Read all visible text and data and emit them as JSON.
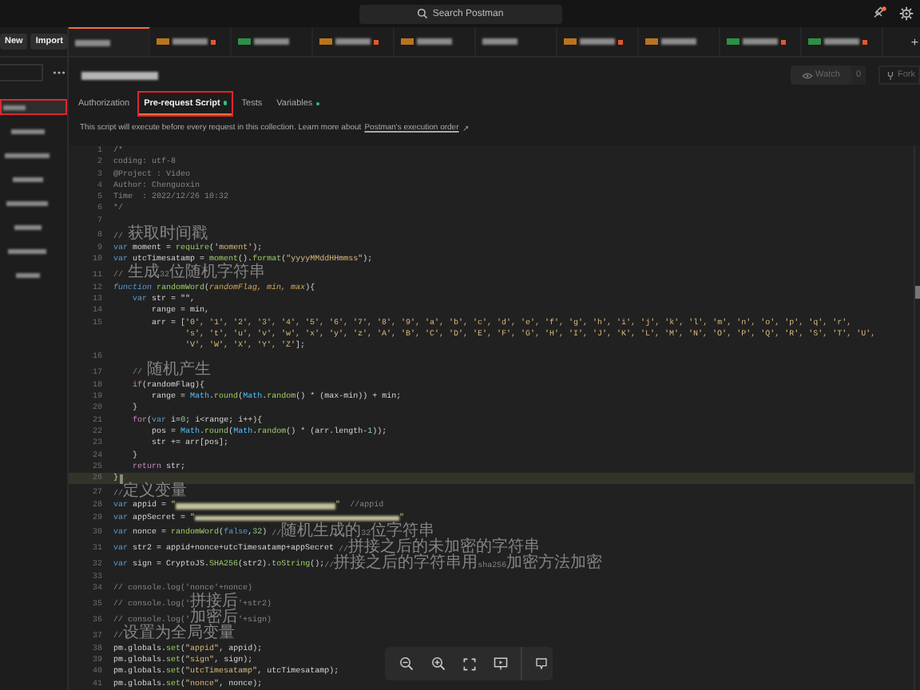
{
  "topbar": {
    "search": {
      "placeholder": "Search Postman"
    },
    "notification": true
  },
  "sidebar": {
    "buttons": [
      "New",
      "Import"
    ],
    "items": [
      {
        "selected": true,
        "highlighted": true
      },
      {
        "selected": false,
        "highlighted": false
      },
      {
        "selected": false,
        "highlighted": false
      },
      {
        "selected": false,
        "highlighted": false
      },
      {
        "selected": false,
        "highlighted": false
      },
      {
        "selected": false,
        "highlighted": false
      },
      {
        "selected": false,
        "highlighted": false
      },
      {
        "selected": false,
        "highlighted": false
      }
    ]
  },
  "tabs": [
    {
      "selected": true,
      "unsaved": false
    },
    {
      "selected": false,
      "color": "#b8741f",
      "unsaved": true
    },
    {
      "selected": false,
      "color": "#2f8f46",
      "unsaved": false
    },
    {
      "selected": false,
      "color": "#b8741f",
      "unsaved": true
    },
    {
      "selected": false,
      "color": "#b8741f",
      "unsaved": false
    },
    {
      "selected": false,
      "unsaved": false
    },
    {
      "selected": false,
      "color": "#b8741f",
      "unsaved": true
    },
    {
      "selected": false,
      "color": "#b8741f",
      "unsaved": false
    },
    {
      "selected": false,
      "color": "#2f8f46",
      "unsaved": true
    },
    {
      "selected": false,
      "color": "#2f8f46",
      "unsaved": true
    }
  ],
  "new_tab": "+",
  "collection": {
    "watch": {
      "label": "Watch",
      "count": "0"
    },
    "fork": {
      "label": "Fork"
    }
  },
  "subtabs": [
    {
      "label": "Authorization",
      "selected": false,
      "dot": false,
      "highlighted": false
    },
    {
      "label": "Pre-request Script",
      "selected": true,
      "dot": true,
      "highlighted": true
    },
    {
      "label": "Tests",
      "selected": false,
      "dot": false,
      "highlighted": false
    },
    {
      "label": "Variables",
      "selected": false,
      "dot": true,
      "highlighted": false
    }
  ],
  "info": {
    "text": "This script will execute before every request in this collection. Learn more about",
    "link": "Postman's execution order",
    "arrow": "↗"
  },
  "editor": {
    "lines": [
      {
        "n": "1",
        "current": false,
        "segs": [
          {
            "kind": "cm",
            "text": "/*"
          }
        ]
      },
      {
        "n": "2",
        "current": false,
        "segs": [
          {
            "kind": "cm",
            "text": "coding: utf-8"
          }
        ]
      },
      {
        "n": "3",
        "current": false,
        "segs": [
          {
            "kind": "cm",
            "text": "@Project : Video"
          }
        ]
      },
      {
        "n": "4",
        "current": false,
        "segs": [
          {
            "kind": "cm",
            "text": "Author: Chenguoxin"
          }
        ]
      },
      {
        "n": "5",
        "current": false,
        "segs": [
          {
            "kind": "cm",
            "text": "Time  : 2022/12/26 10:32"
          }
        ]
      },
      {
        "n": "6",
        "current": false,
        "segs": [
          {
            "kind": "cm",
            "text": "*/"
          }
        ]
      },
      {
        "n": "7",
        "current": false
      },
      {
        "n": "8",
        "current": false,
        "segs": [
          {
            "kind": "cm",
            "text": "// 获取时间戳"
          }
        ]
      },
      {
        "n": "9",
        "current": false,
        "segs": [
          {
            "kind": "kw",
            "text": "var"
          },
          {
            "kind": "pl",
            "text": " moment = "
          },
          {
            "kind": "fn",
            "text": "require"
          },
          {
            "kind": "pl",
            "text": "("
          },
          {
            "kind": "str",
            "text": "'moment'"
          },
          {
            "kind": "pl",
            "text": ");"
          }
        ]
      },
      {
        "n": "10",
        "current": false,
        "segs": [
          {
            "kind": "kw",
            "text": "var"
          },
          {
            "kind": "pl",
            "text": " utcTimesatamp = "
          },
          {
            "kind": "fn",
            "text": "moment"
          },
          {
            "kind": "pl",
            "text": "()."
          },
          {
            "kind": "fn",
            "text": "format"
          },
          {
            "kind": "pl",
            "text": "("
          },
          {
            "kind": "str",
            "text": "\"yyyyMMddHHmmss\""
          },
          {
            "kind": "pl",
            "text": ");"
          }
        ]
      },
      {
        "n": "11",
        "current": false,
        "segs": [
          {
            "kind": "cm",
            "text": "// 生成32位随机字符串"
          }
        ]
      },
      {
        "n": "12",
        "current": false,
        "segs": [
          {
            "kind": "kwi",
            "text": "function"
          },
          {
            "kind": "fn",
            "text": " randomWord"
          },
          {
            "kind": "pl",
            "text": "("
          },
          {
            "kind": "param",
            "text": "randomFlag, min, max"
          },
          {
            "kind": "pl",
            "text": "){"
          }
        ]
      },
      {
        "n": "13",
        "current": false,
        "segs": [
          {
            "kind": "kw",
            "text": "    var"
          },
          {
            "kind": "pl",
            "text": " str = \"\","
          }
        ]
      },
      {
        "n": "14",
        "current": false,
        "segs": [
          {
            "kind": "pl",
            "text": "        range = min,"
          }
        ]
      },
      {
        "n": "15",
        "current": false,
        "segs": [
          {
            "kind": "pl",
            "text": "        arr = ["
          },
          {
            "kind": "str",
            "text": "'0', '1', '2', '3', '4', '5', '6', '7', '8', '9', 'a', 'b', 'c', 'd', 'e', 'f', 'g', 'h', 'i', 'j', 'k', 'l', 'm', 'n', 'o', 'p', 'q', 'r',"
          }
        ]
      },
      {
        "current": false,
        "segs": [
          {
            "kind": "str",
            "text": "               's', 't', 'u', 'v', 'w', 'x', 'y', 'z', 'A', 'B', 'C', 'D', 'E', 'F', 'G', 'H', 'I', 'J', 'K', 'L', 'M', 'N', 'O', 'P', 'Q', 'R', 'S', 'T', 'U',"
          }
        ]
      },
      {
        "current": false,
        "segs": [
          {
            "kind": "str",
            "text": "               'V', 'W', 'X', 'Y', 'Z'"
          },
          {
            "kind": "pl",
            "text": "];"
          }
        ]
      },
      {
        "n": "16",
        "current": false
      },
      {
        "n": "17",
        "current": false,
        "segs": [
          {
            "kind": "cm",
            "text": "    // 随机产生"
          }
        ]
      },
      {
        "n": "18",
        "current": false,
        "segs": [
          {
            "kind": "ctl",
            "text": "    if"
          },
          {
            "kind": "pl",
            "text": "(randomFlag){"
          }
        ]
      },
      {
        "n": "19",
        "current": false,
        "segs": [
          {
            "kind": "pl",
            "text": "        range = "
          },
          {
            "kind": "obj",
            "text": "Math"
          },
          {
            "kind": "pl",
            "text": "."
          },
          {
            "kind": "fn",
            "text": "round"
          },
          {
            "kind": "pl",
            "text": "("
          },
          {
            "kind": "obj",
            "text": "Math"
          },
          {
            "kind": "pl",
            "text": "."
          },
          {
            "kind": "fn",
            "text": "random"
          },
          {
            "kind": "pl",
            "text": "() * (max-min)) + min;"
          }
        ]
      },
      {
        "n": "20",
        "current": false,
        "segs": [
          {
            "kind": "pl",
            "text": "    }"
          }
        ]
      },
      {
        "n": "21",
        "current": false,
        "segs": [
          {
            "kind": "ctl",
            "text": "    for"
          },
          {
            "kind": "pl",
            "text": "("
          },
          {
            "kind": "kw",
            "text": "var"
          },
          {
            "kind": "pl",
            "text": " i="
          },
          {
            "kind": "num",
            "text": "0"
          },
          {
            "kind": "pl",
            "text": "; i<range; i++){"
          }
        ]
      },
      {
        "n": "22",
        "current": false,
        "segs": [
          {
            "kind": "pl",
            "text": "        pos = "
          },
          {
            "kind": "obj",
            "text": "Math"
          },
          {
            "kind": "pl",
            "text": "."
          },
          {
            "kind": "fn",
            "text": "round"
          },
          {
            "kind": "pl",
            "text": "("
          },
          {
            "kind": "obj",
            "text": "Math"
          },
          {
            "kind": "pl",
            "text": "."
          },
          {
            "kind": "fn",
            "text": "random"
          },
          {
            "kind": "pl",
            "text": "() * (arr.length-"
          },
          {
            "kind": "num",
            "text": "1"
          },
          {
            "kind": "pl",
            "text": "));"
          }
        ]
      },
      {
        "n": "23",
        "current": false,
        "segs": [
          {
            "kind": "pl",
            "text": "        str += arr[pos];"
          }
        ]
      },
      {
        "n": "24",
        "current": false,
        "segs": [
          {
            "kind": "pl",
            "text": "    }"
          }
        ]
      },
      {
        "n": "25",
        "current": false,
        "segs": [
          {
            "kind": "ctl",
            "text": "    return"
          },
          {
            "kind": "pl",
            "text": " str;"
          }
        ]
      },
      {
        "n": "26",
        "current": true,
        "segs": [
          {
            "kind": "pl",
            "text": "}"
          }
        ]
      },
      {
        "n": "27",
        "current": false,
        "segs": [
          {
            "kind": "cm",
            "text": "//定义变量"
          }
        ]
      },
      {
        "n": "28",
        "current": false,
        "segs": [
          {
            "kind": "kw",
            "text": "var"
          },
          {
            "kind": "pl",
            "text": " appid = "
          },
          {
            "kind": "str",
            "text": "\""
          },
          {
            "kind": "redacted"
          },
          {
            "kind": "str",
            "text": "\""
          },
          {
            "kind": "cm",
            "text": "  //appid"
          }
        ]
      },
      {
        "n": "29",
        "current": false,
        "segs": [
          {
            "kind": "kw",
            "text": "var"
          },
          {
            "kind": "pl",
            "text": " appSecret = "
          },
          {
            "kind": "str",
            "text": "\""
          },
          {
            "kind": "redacted_long"
          },
          {
            "kind": "str",
            "text": "\""
          }
        ]
      },
      {
        "n": "30",
        "current": false,
        "segs": [
          {
            "kind": "kw",
            "text": "var"
          },
          {
            "kind": "pl",
            "text": " nonce = "
          },
          {
            "kind": "fn",
            "text": "randomWord"
          },
          {
            "kind": "pl",
            "text": "("
          },
          {
            "kind": "kw",
            "text": "false"
          },
          {
            "kind": "pl",
            "text": ","
          },
          {
            "kind": "num",
            "text": "32"
          },
          {
            "kind": "pl",
            "text": ") "
          },
          {
            "kind": "cm",
            "text": "//随机生成的32位字符串"
          }
        ]
      },
      {
        "n": "31",
        "current": false,
        "segs": [
          {
            "kind": "kw",
            "text": "var"
          },
          {
            "kind": "pl",
            "text": " str2 = appid+nonce+utcTimesatamp+appSecret "
          },
          {
            "kind": "cm",
            "text": "//拼接之后的未加密的字符串"
          }
        ]
      },
      {
        "n": "32",
        "current": false,
        "segs": [
          {
            "kind": "kw",
            "text": "var"
          },
          {
            "kind": "pl",
            "text": " sign = CryptoJS."
          },
          {
            "kind": "fn",
            "text": "SHA256"
          },
          {
            "kind": "pl",
            "text": "(str2)."
          },
          {
            "kind": "fn",
            "text": "toString"
          },
          {
            "kind": "pl",
            "text": "();"
          },
          {
            "kind": "cm",
            "text": "//拼接之后的字符串用sha256加密方法加密"
          }
        ]
      },
      {
        "n": "33",
        "current": false
      },
      {
        "n": "34",
        "current": false,
        "segs": [
          {
            "kind": "cm",
            "text": "// console.log('nonce'+nonce)"
          }
        ]
      },
      {
        "n": "35",
        "current": false,
        "segs": [
          {
            "kind": "cm",
            "text": "// console.log('拼接后'+str2)"
          }
        ]
      },
      {
        "n": "36",
        "current": false,
        "segs": [
          {
            "kind": "cm",
            "text": "// console.log('加密后'+sign)"
          }
        ]
      },
      {
        "n": "37",
        "current": false,
        "segs": [
          {
            "kind": "cm",
            "text": "//设置为全局变量"
          }
        ]
      },
      {
        "n": "38",
        "current": false,
        "segs": [
          {
            "kind": "pl",
            "text": "pm.globals."
          },
          {
            "kind": "fn",
            "text": "set"
          },
          {
            "kind": "pl",
            "text": "("
          },
          {
            "kind": "str",
            "text": "\"appid\""
          },
          {
            "kind": "pl",
            "text": ", appid);"
          }
        ]
      },
      {
        "n": "39",
        "current": false,
        "segs": [
          {
            "kind": "pl",
            "text": "pm.globals."
          },
          {
            "kind": "fn",
            "text": "set"
          },
          {
            "kind": "pl",
            "text": "("
          },
          {
            "kind": "str",
            "text": "\"sign\""
          },
          {
            "kind": "pl",
            "text": ", sign);"
          }
        ]
      },
      {
        "n": "40",
        "current": false,
        "segs": [
          {
            "kind": "pl",
            "text": "pm.globals."
          },
          {
            "kind": "fn",
            "text": "set"
          },
          {
            "kind": "pl",
            "text": "("
          },
          {
            "kind": "str",
            "text": "\"utcTimesatamp\""
          },
          {
            "kind": "pl",
            "text": ", utcTimesatamp);"
          }
        ]
      },
      {
        "n": "41",
        "current": false,
        "segs": [
          {
            "kind": "pl",
            "text": "pm.globals."
          },
          {
            "kind": "fn",
            "text": "set"
          },
          {
            "kind": "pl",
            "text": "("
          },
          {
            "kind": "str",
            "text": "\"nonce\""
          },
          {
            "kind": "pl",
            "text": ", nonce);"
          }
        ]
      }
    ]
  }
}
